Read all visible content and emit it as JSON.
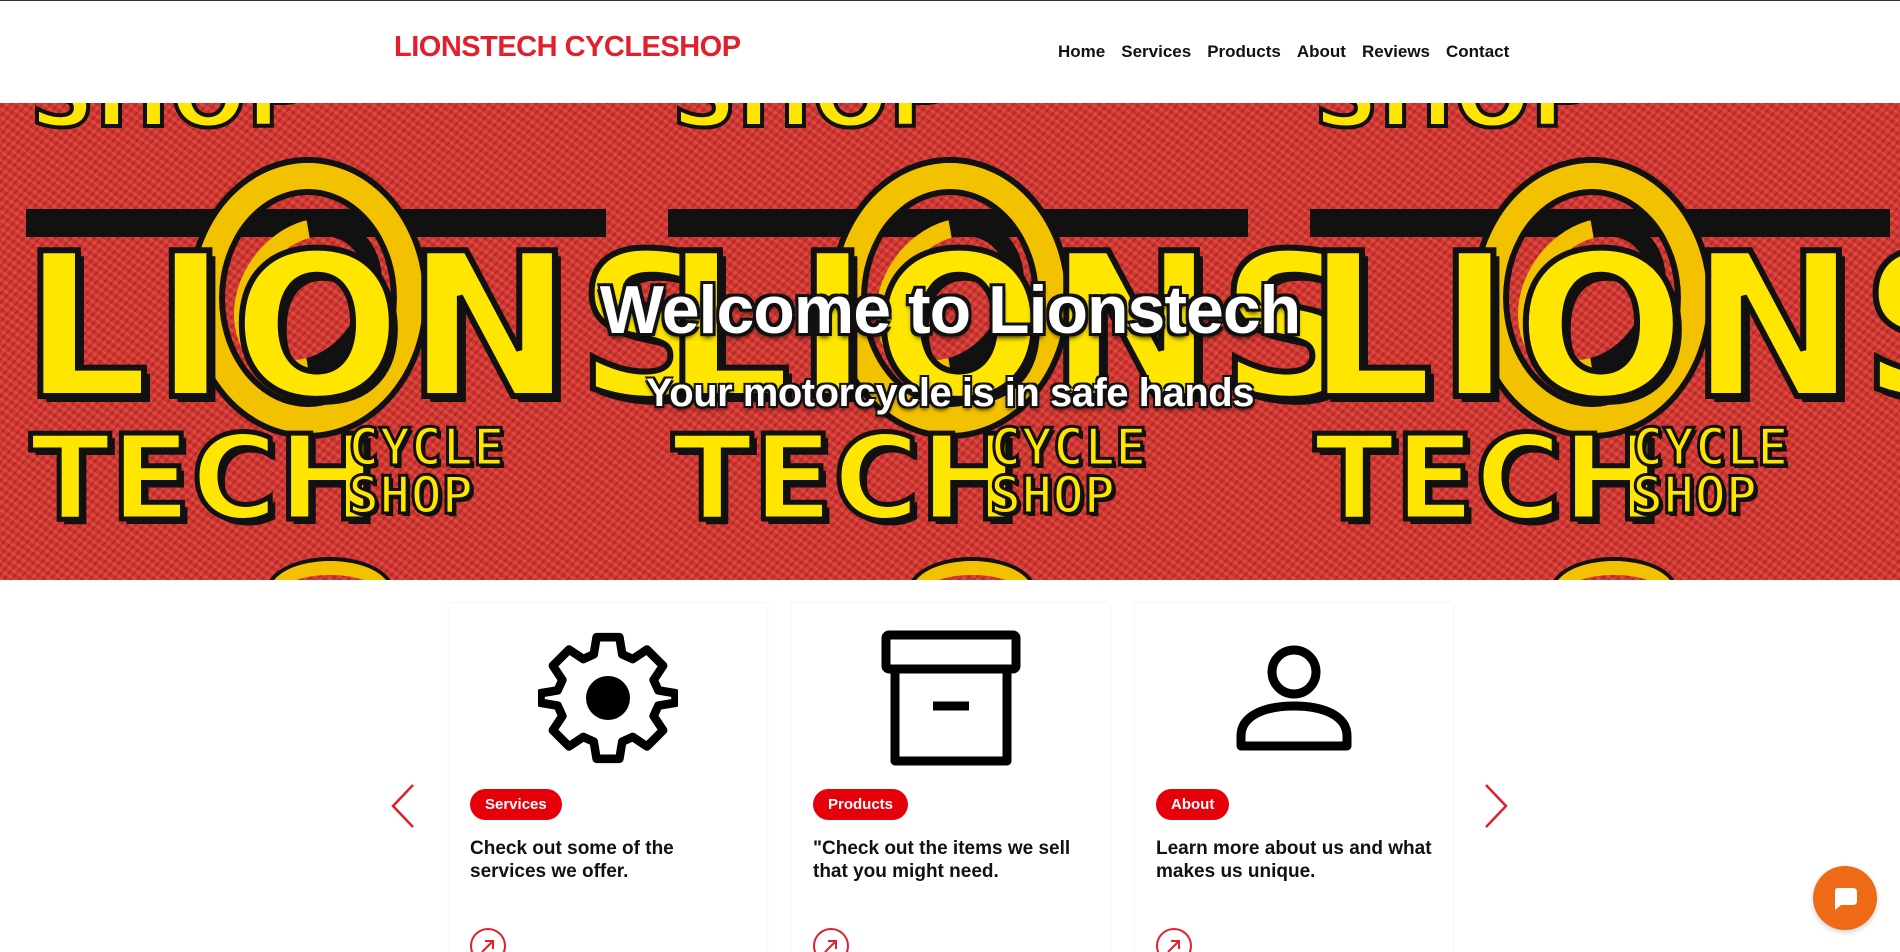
{
  "header": {
    "brand": "LIONSTECH CYCLESHOP",
    "nav": [
      "Home",
      "Services",
      "Products",
      "About",
      "Reviews",
      "Contact"
    ]
  },
  "hero": {
    "title": "Welcome to Lionstech",
    "subtitle": "Your motorcycle is in safe hands",
    "banner_logo": {
      "word": "LIONS",
      "tech": "TECH",
      "cycle": "CYCLE",
      "shop": "SHOP"
    }
  },
  "cards": [
    {
      "badge": "Services",
      "description": "Check out some of the services we offer.",
      "icon": "gear-icon"
    },
    {
      "badge": "Products",
      "description": "\"Check out the items we sell that you might need.",
      "icon": "archive-box-icon"
    },
    {
      "badge": "About",
      "description": "Learn more about us and what makes us unique.",
      "icon": "person-icon"
    }
  ],
  "colors": {
    "brand_red": "#e21f2c",
    "badge_red": "#e6000a",
    "chat_orange": "#ef6a17",
    "banner_yellow": "#ffe600"
  },
  "carousel": {
    "prev_icon": "chevron-left-icon",
    "next_icon": "chevron-right-icon"
  },
  "chat": {
    "icon": "chat-bubble-icon"
  }
}
